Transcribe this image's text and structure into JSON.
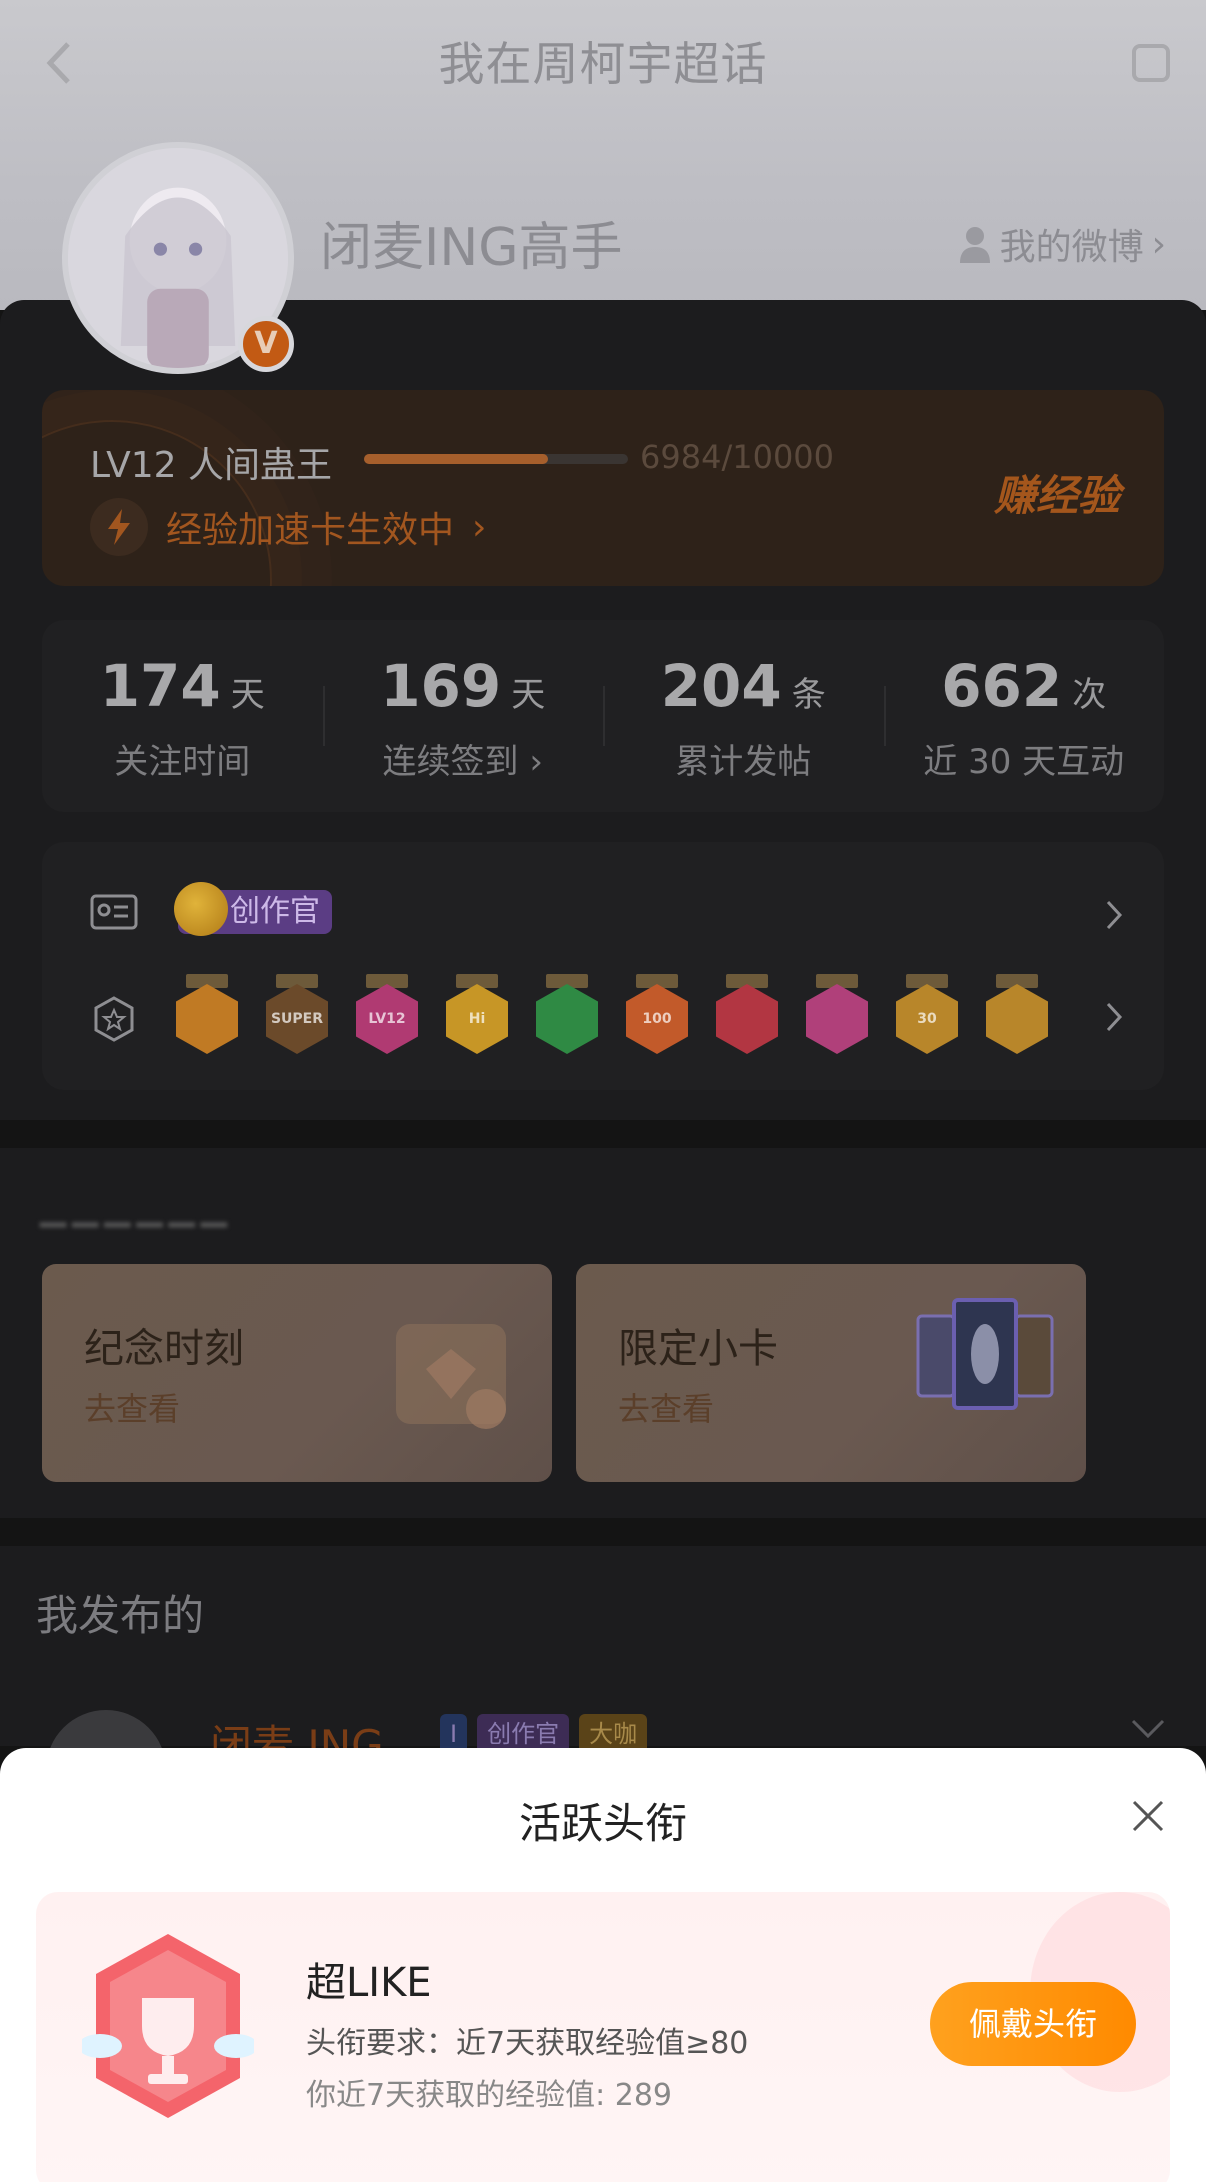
{
  "header": {
    "title": "我在周柯宇超话",
    "nickname": "闭麦ING高手",
    "my_weibo": "我的微博",
    "verified_badge": "V"
  },
  "level": {
    "label": "LV12 人间蛊王",
    "progress_text": "6984/10000",
    "progress_fraction": 0.6984,
    "boost_text": "经验加速卡生效中",
    "earn_label": "赚经验"
  },
  "stats": [
    {
      "value": "174",
      "unit": "天",
      "label": "关注时间"
    },
    {
      "value": "169",
      "unit": "天",
      "label": "连续签到 ›"
    },
    {
      "value": "204",
      "unit": "条",
      "label": "累计发帖"
    },
    {
      "value": "662",
      "unit": "次",
      "label": "近 30 天互动"
    }
  ],
  "badges": {
    "creator_tag": "创作官",
    "medals": [
      {
        "icon": "crown-medal",
        "color": "#c07a24",
        "text": ""
      },
      {
        "icon": "super-crown-medal",
        "color": "#6b4a2a",
        "text": "SUPER"
      },
      {
        "icon": "lv12-medal",
        "color": "#b03a72",
        "text": "LV12"
      },
      {
        "icon": "hi-medal",
        "color": "#c79626",
        "text": "Hi"
      },
      {
        "icon": "hand-medal",
        "color": "#2f8a44",
        "text": ""
      },
      {
        "icon": "100-days-medal",
        "color": "#c25a2a",
        "text": "100"
      },
      {
        "icon": "trophy-medal",
        "color": "#b23642",
        "text": ""
      },
      {
        "icon": "cap-medal",
        "color": "#b0407a",
        "text": ""
      },
      {
        "icon": "30-days-medal",
        "color": "#b8862a",
        "text": "30"
      },
      {
        "icon": "partial-medal",
        "color": "#b8862a",
        "text": ""
      }
    ]
  },
  "cards": [
    {
      "title": "纪念时刻",
      "sub": "去查看"
    },
    {
      "title": "限定小卡",
      "sub": "去查看"
    }
  ],
  "published": {
    "title": "我发布的",
    "post_name": "闭麦 ING ...",
    "tags": [
      "I",
      "创作官",
      "大咖"
    ]
  },
  "sheet": {
    "title": "活跃头衔",
    "item_name": "超LIKE",
    "requirement": "头衔要求：近7天获取经验值≥80",
    "progress": "你近7天获取的经验值: 289",
    "wear_button": "佩戴头衔"
  }
}
